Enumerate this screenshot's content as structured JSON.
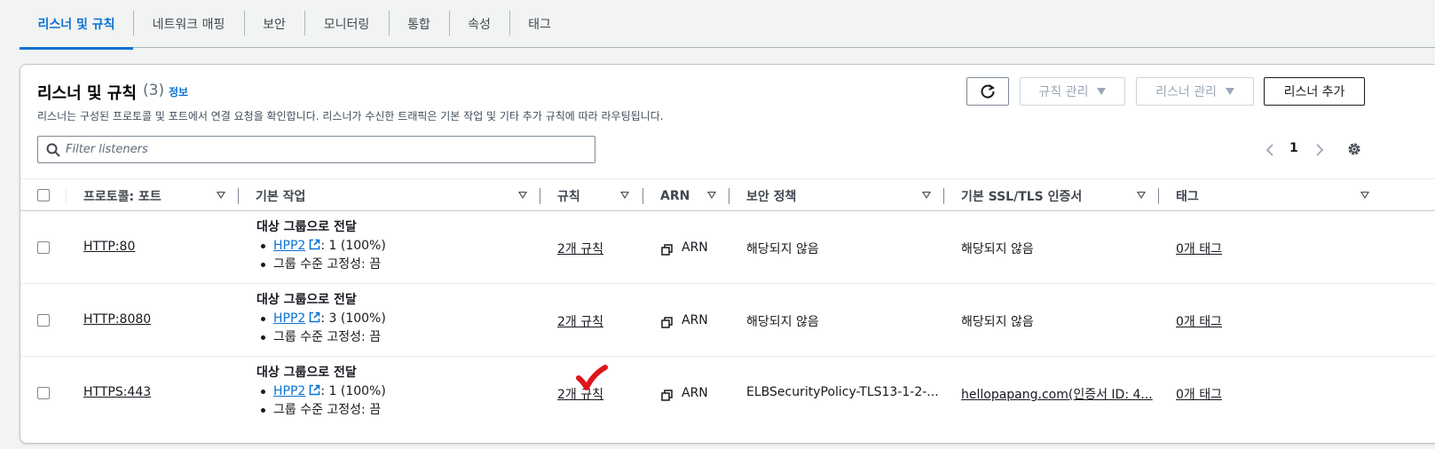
{
  "tabs": [
    "리스너 및 규칙",
    "네트워크 매핑",
    "보안",
    "모니터링",
    "통합",
    "속성",
    "태그"
  ],
  "panel": {
    "title": "리스너 및 규칙",
    "count": "(3)",
    "info": "정보",
    "description": "리스너는 구성된 프로토콜 및 포트에서 연결 요청을 확인합니다. 리스너가 수신한 트래픽은 기본 작업 및 기타 추가 규칙에 따라 라우팅됩니다."
  },
  "toolbar": {
    "manage_rules": "규칙 관리",
    "manage_listeners": "리스너 관리",
    "add_listener": "리스너 추가"
  },
  "search": {
    "placeholder": "Filter listeners"
  },
  "pagination": {
    "page": "1"
  },
  "table": {
    "headers": [
      "프로토콜: 포트",
      "기본 작업",
      "규칙",
      "ARN",
      "보안 정책",
      "기본 SSL/TLS 인증서",
      "태그"
    ],
    "rows": [
      {
        "protocol_port": "HTTP:80",
        "action_title": "대상 그룹으로 전달",
        "target": "HPP2",
        "weight": ": 1 (100%)",
        "stickiness": "그룹 수준 고정성: 끔",
        "rules": "2개 규칙",
        "arn": "ARN",
        "security_policy": "해당되지 않음",
        "certificate": "해당되지 않음",
        "tags": "0개 태그"
      },
      {
        "protocol_port": "HTTP:8080",
        "action_title": "대상 그룹으로 전달",
        "target": "HPP2",
        "weight": ": 3 (100%)",
        "stickiness": "그룹 수준 고정성: 끔",
        "rules": "2개 규칙",
        "arn": "ARN",
        "security_policy": "해당되지 않음",
        "certificate": "해당되지 않음",
        "tags": "0개 태그"
      },
      {
        "protocol_port": "HTTPS:443",
        "action_title": "대상 그룹으로 전달",
        "target": "HPP2",
        "weight": ": 1 (100%)",
        "stickiness": "그룹 수준 고정성: 끔",
        "rules": "2개 규칙",
        "arn": "ARN",
        "security_policy": "ELBSecurityPolicy-TLS13-1-2-...",
        "certificate": "hellopapang.com(인증서 ID: 4...",
        "tags": "0개 태그"
      }
    ]
  },
  "colors": {
    "accent": "#0972d3",
    "annotation": "#e0151b"
  }
}
